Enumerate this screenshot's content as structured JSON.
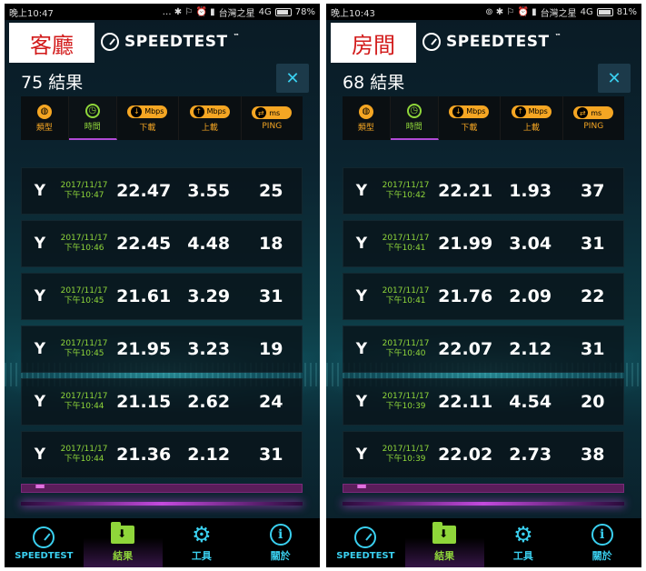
{
  "colors": {
    "accent_cyan": "#3ad0f0",
    "accent_green": "#8fd63a",
    "accent_orange": "#f5a623",
    "accent_purple": "#c44adf",
    "room_label_red": "#d21a1a"
  },
  "left": {
    "status": {
      "time": "晚上10:47",
      "carrier": "台灣之星",
      "network": "4G",
      "battery": "78%",
      "icons": "… ✱ ⚐ ⏰ ▮"
    },
    "room_label": "客廳",
    "brand": "SPEEDTEST",
    "brand_tm": "™",
    "results_count": "75 結果",
    "sort": {
      "type_label": "類型",
      "time_label": "時間",
      "download_label": "下載",
      "upload_label": "上載",
      "ping_label": "PING",
      "unit_mbps": "Mbps",
      "unit_ms": "ms"
    },
    "rows": [
      {
        "date": "2017/11/17",
        "time": "下午10:47",
        "download": "22.47",
        "upload": "3.55",
        "ping": "25"
      },
      {
        "date": "2017/11/17",
        "time": "下午10:46",
        "download": "22.45",
        "upload": "4.48",
        "ping": "18"
      },
      {
        "date": "2017/11/17",
        "time": "下午10:45",
        "download": "21.61",
        "upload": "3.29",
        "ping": "31"
      },
      {
        "date": "2017/11/17",
        "time": "下午10:45",
        "download": "21.95",
        "upload": "3.23",
        "ping": "19"
      },
      {
        "date": "2017/11/17",
        "time": "下午10:44",
        "download": "21.15",
        "upload": "2.62",
        "ping": "24"
      },
      {
        "date": "2017/11/17",
        "time": "下午10:44",
        "download": "21.36",
        "upload": "2.12",
        "ping": "31"
      }
    ],
    "nav": {
      "speedtest": "SPEEDTEST",
      "results": "結果",
      "tools": "工具",
      "about": "關於"
    }
  },
  "right": {
    "status": {
      "time": "晚上10:43",
      "carrier": "台灣之星",
      "network": "4G",
      "battery": "81%",
      "icons": "⊚ ✱ ⚐ ⏰ ▮"
    },
    "room_label": "房間",
    "brand": "SPEEDTEST",
    "brand_tm": "™",
    "results_count": "68 結果",
    "sort": {
      "type_label": "類型",
      "time_label": "時間",
      "download_label": "下載",
      "upload_label": "上載",
      "ping_label": "PING",
      "unit_mbps": "Mbps",
      "unit_ms": "ms"
    },
    "rows": [
      {
        "date": "2017/11/17",
        "time": "下午10:42",
        "download": "22.21",
        "upload": "1.93",
        "ping": "37"
      },
      {
        "date": "2017/11/17",
        "time": "下午10:41",
        "download": "21.99",
        "upload": "3.04",
        "ping": "31"
      },
      {
        "date": "2017/11/17",
        "time": "下午10:41",
        "download": "21.76",
        "upload": "2.09",
        "ping": "22"
      },
      {
        "date": "2017/11/17",
        "time": "下午10:40",
        "download": "22.07",
        "upload": "2.12",
        "ping": "31"
      },
      {
        "date": "2017/11/17",
        "time": "下午10:39",
        "download": "22.11",
        "upload": "4.54",
        "ping": "20"
      },
      {
        "date": "2017/11/17",
        "time": "下午10:39",
        "download": "22.02",
        "upload": "2.73",
        "ping": "38"
      }
    ],
    "nav": {
      "speedtest": "SPEEDTEST",
      "results": "結果",
      "tools": "工具",
      "about": "關於"
    }
  }
}
